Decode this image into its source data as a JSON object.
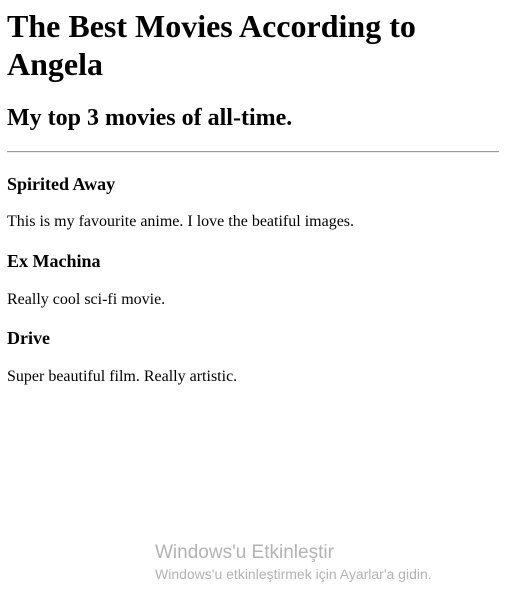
{
  "page": {
    "title": "The Best Movies According to Angela",
    "subtitle": "My top 3 movies of all-time."
  },
  "movies": [
    {
      "title": "Spirited Away",
      "description": "This is my favourite anime. I love the beatiful images."
    },
    {
      "title": "Ex Machina",
      "description": "Really cool sci-fi movie."
    },
    {
      "title": "Drive",
      "description": "Super beautiful film. Really artistic."
    }
  ],
  "watermark": {
    "title": "Windows'u Etkinleştir",
    "subtitle": "Windows'u etkinleştirmek için Ayarlar'a gidin."
  }
}
